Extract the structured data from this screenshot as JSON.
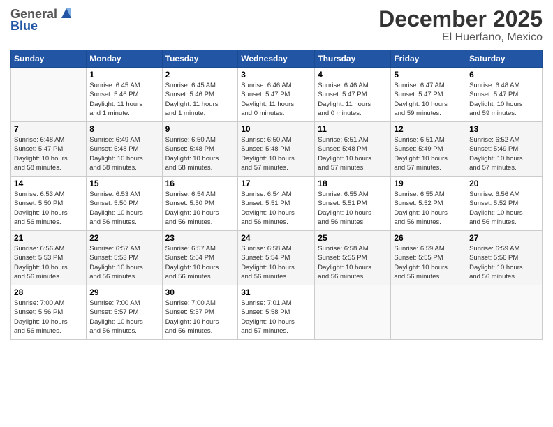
{
  "header": {
    "logo_line1": "General",
    "logo_line2": "Blue",
    "month": "December 2025",
    "location": "El Huerfano, Mexico"
  },
  "weekdays": [
    "Sunday",
    "Monday",
    "Tuesday",
    "Wednesday",
    "Thursday",
    "Friday",
    "Saturday"
  ],
  "weeks": [
    [
      {
        "day": "",
        "info": ""
      },
      {
        "day": "1",
        "info": "Sunrise: 6:45 AM\nSunset: 5:46 PM\nDaylight: 11 hours\nand 1 minute."
      },
      {
        "day": "2",
        "info": "Sunrise: 6:45 AM\nSunset: 5:46 PM\nDaylight: 11 hours\nand 1 minute."
      },
      {
        "day": "3",
        "info": "Sunrise: 6:46 AM\nSunset: 5:47 PM\nDaylight: 11 hours\nand 0 minutes."
      },
      {
        "day": "4",
        "info": "Sunrise: 6:46 AM\nSunset: 5:47 PM\nDaylight: 11 hours\nand 0 minutes."
      },
      {
        "day": "5",
        "info": "Sunrise: 6:47 AM\nSunset: 5:47 PM\nDaylight: 10 hours\nand 59 minutes."
      },
      {
        "day": "6",
        "info": "Sunrise: 6:48 AM\nSunset: 5:47 PM\nDaylight: 10 hours\nand 59 minutes."
      }
    ],
    [
      {
        "day": "7",
        "info": "Sunrise: 6:48 AM\nSunset: 5:47 PM\nDaylight: 10 hours\nand 58 minutes."
      },
      {
        "day": "8",
        "info": "Sunrise: 6:49 AM\nSunset: 5:48 PM\nDaylight: 10 hours\nand 58 minutes."
      },
      {
        "day": "9",
        "info": "Sunrise: 6:50 AM\nSunset: 5:48 PM\nDaylight: 10 hours\nand 58 minutes."
      },
      {
        "day": "10",
        "info": "Sunrise: 6:50 AM\nSunset: 5:48 PM\nDaylight: 10 hours\nand 57 minutes."
      },
      {
        "day": "11",
        "info": "Sunrise: 6:51 AM\nSunset: 5:48 PM\nDaylight: 10 hours\nand 57 minutes."
      },
      {
        "day": "12",
        "info": "Sunrise: 6:51 AM\nSunset: 5:49 PM\nDaylight: 10 hours\nand 57 minutes."
      },
      {
        "day": "13",
        "info": "Sunrise: 6:52 AM\nSunset: 5:49 PM\nDaylight: 10 hours\nand 57 minutes."
      }
    ],
    [
      {
        "day": "14",
        "info": "Sunrise: 6:53 AM\nSunset: 5:50 PM\nDaylight: 10 hours\nand 56 minutes."
      },
      {
        "day": "15",
        "info": "Sunrise: 6:53 AM\nSunset: 5:50 PM\nDaylight: 10 hours\nand 56 minutes."
      },
      {
        "day": "16",
        "info": "Sunrise: 6:54 AM\nSunset: 5:50 PM\nDaylight: 10 hours\nand 56 minutes."
      },
      {
        "day": "17",
        "info": "Sunrise: 6:54 AM\nSunset: 5:51 PM\nDaylight: 10 hours\nand 56 minutes."
      },
      {
        "day": "18",
        "info": "Sunrise: 6:55 AM\nSunset: 5:51 PM\nDaylight: 10 hours\nand 56 minutes."
      },
      {
        "day": "19",
        "info": "Sunrise: 6:55 AM\nSunset: 5:52 PM\nDaylight: 10 hours\nand 56 minutes."
      },
      {
        "day": "20",
        "info": "Sunrise: 6:56 AM\nSunset: 5:52 PM\nDaylight: 10 hours\nand 56 minutes."
      }
    ],
    [
      {
        "day": "21",
        "info": "Sunrise: 6:56 AM\nSunset: 5:53 PM\nDaylight: 10 hours\nand 56 minutes."
      },
      {
        "day": "22",
        "info": "Sunrise: 6:57 AM\nSunset: 5:53 PM\nDaylight: 10 hours\nand 56 minutes."
      },
      {
        "day": "23",
        "info": "Sunrise: 6:57 AM\nSunset: 5:54 PM\nDaylight: 10 hours\nand 56 minutes."
      },
      {
        "day": "24",
        "info": "Sunrise: 6:58 AM\nSunset: 5:54 PM\nDaylight: 10 hours\nand 56 minutes."
      },
      {
        "day": "25",
        "info": "Sunrise: 6:58 AM\nSunset: 5:55 PM\nDaylight: 10 hours\nand 56 minutes."
      },
      {
        "day": "26",
        "info": "Sunrise: 6:59 AM\nSunset: 5:55 PM\nDaylight: 10 hours\nand 56 minutes."
      },
      {
        "day": "27",
        "info": "Sunrise: 6:59 AM\nSunset: 5:56 PM\nDaylight: 10 hours\nand 56 minutes."
      }
    ],
    [
      {
        "day": "28",
        "info": "Sunrise: 7:00 AM\nSunset: 5:56 PM\nDaylight: 10 hours\nand 56 minutes."
      },
      {
        "day": "29",
        "info": "Sunrise: 7:00 AM\nSunset: 5:57 PM\nDaylight: 10 hours\nand 56 minutes."
      },
      {
        "day": "30",
        "info": "Sunrise: 7:00 AM\nSunset: 5:57 PM\nDaylight: 10 hours\nand 56 minutes."
      },
      {
        "day": "31",
        "info": "Sunrise: 7:01 AM\nSunset: 5:58 PM\nDaylight: 10 hours\nand 57 minutes."
      },
      {
        "day": "",
        "info": ""
      },
      {
        "day": "",
        "info": ""
      },
      {
        "day": "",
        "info": ""
      }
    ]
  ]
}
